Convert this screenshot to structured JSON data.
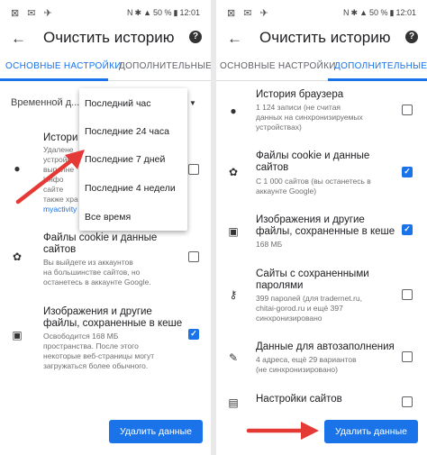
{
  "status": {
    "left_icons": "⊠ ✉ ✈",
    "right": [
      "N",
      "✱",
      "50 %",
      "12:01"
    ]
  },
  "left": {
    "title": "Очистить историю",
    "tabs": [
      "ОСНОВНЫЕ НАСТРОЙКИ",
      "ДОПОЛНИТЕЛЬНЫЕ"
    ],
    "time_range_label": "Временной д...",
    "dropdown": [
      "Последний час",
      "Последние 24 часа",
      "Последние 7 дней",
      "Последние 4 недели",
      "Все время"
    ],
    "history": {
      "title": "Истори",
      "lines": [
        "Удалене",
        "устройс",
        "выполне",
        "Инфо",
        "сайте",
        "также хра",
        "myactivity"
      ]
    },
    "cookies": {
      "title_l1": "Файлы cookie и данные",
      "title_l2": "сайтов",
      "sub_l1": "Вы выйдете из аккаунтов",
      "sub_l2": "на большинстве сайтов, но",
      "sub_l3": "останетесь в аккаунте Google."
    },
    "cache": {
      "title_l1": "Изображения и другие",
      "title_l2": "файлы, сохраненные в кеше",
      "sub_l1": "Освободится 168 МБ",
      "sub_l2": "пространства. После этого",
      "sub_l3": "некоторые веб-страницы могут",
      "sub_l4": "загружаться более обычного."
    },
    "button": "Удалить данные"
  },
  "right": {
    "title": "Очистить историю",
    "tabs": [
      "ОСНОВНЫЕ НАСТРОЙКИ",
      "ДОПОЛНИТЕЛЬНЫЕ"
    ],
    "history": {
      "title": "История браузера",
      "sub_l1": "1 124 записи (не считая",
      "sub_l2": "данных на синхронизируемых",
      "sub_l3": "устройствах)"
    },
    "cookies": {
      "title_l1": "Файлы cookie и данные",
      "title_l2": "сайтов",
      "sub_l1": "С 1 000 сайтов (вы останетесь в",
      "sub_l2": "аккаунте Google)"
    },
    "cache": {
      "title_l1": "Изображения и другие",
      "title_l2": "файлы, сохраненные в кеше",
      "sub_l1": "168 МБ"
    },
    "passwords": {
      "title_l1": "Сайты с сохраненными",
      "title_l2": "паролями",
      "sub_l1": "399 паролей (для tradernet.ru,",
      "sub_l2": "chitai-gorod.ru и ещё 397",
      "sub_l3": "синхронизировано"
    },
    "autofill": {
      "title": "Данные для автозаполнения",
      "sub_l1": "4 адреса, ещё 29 вариантов",
      "sub_l2": "(не синхронизировано)"
    },
    "site_settings": {
      "title": "Настройки сайтов"
    },
    "button": "Удалить данные"
  },
  "colors": {
    "accent": "#1a73e8",
    "arrow": "#e53935"
  }
}
